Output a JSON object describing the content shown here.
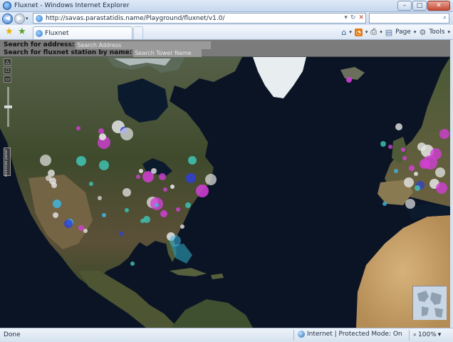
{
  "window": {
    "title": "Fluxnet - Windows Internet Explorer",
    "controls": {
      "minimize": "–",
      "maximize": "□",
      "close": "✕"
    }
  },
  "addressbar": {
    "url": "http://savas.parastatidis.name/Playground/fluxnet/v1.0/",
    "nav_back_glyph": "◀",
    "nav_forward_glyph": "▶",
    "dropdown_glyph": "▾",
    "refresh_glyph": "↻",
    "stop_glyph": "✕",
    "search_icon": "⌕"
  },
  "tabs": [
    {
      "label": "Fluxnet",
      "active": true
    }
  ],
  "commandbar": {
    "favorites_icon": "★",
    "add_favorites_icon": "★",
    "home_icon": "⌂",
    "feeds_icon": "◔",
    "print_icon": "⎙",
    "page_icon": "▤",
    "page_label": "Page",
    "tools_icon": "⚙",
    "tools_label": "Tools",
    "caret": "▾"
  },
  "search_panel": {
    "address_label": "Search for address:",
    "address_placeholder": "Search Address",
    "station_label": "Search for fluxnet station by name:",
    "station_placeholder": "Search Tower Name"
  },
  "map": {
    "minimize_control_label": "minimize panel",
    "controls": {
      "rotate": "△",
      "fit": "☐",
      "mode": "▭"
    },
    "colors": {
      "ocean": "#0a1424",
      "land_green": "#3f4d2c",
      "land_brown": "#6b5a3e",
      "ice": "#e8edf0",
      "desert": "#c9a46a",
      "marker_magenta": "#d23fd6",
      "marker_teal": "#3fc7b8",
      "marker_white": "#e6e6e6",
      "marker_blue": "#2f3fd6",
      "marker_cyan": "#3fb6e0",
      "marker_gray": "#b8b8b8"
    }
  },
  "status": {
    "text": "Done",
    "zone": "Internet | Protected Mode: On",
    "zoom": "100%",
    "zoom_caret": "▾",
    "zoom_icon": "⌕"
  }
}
